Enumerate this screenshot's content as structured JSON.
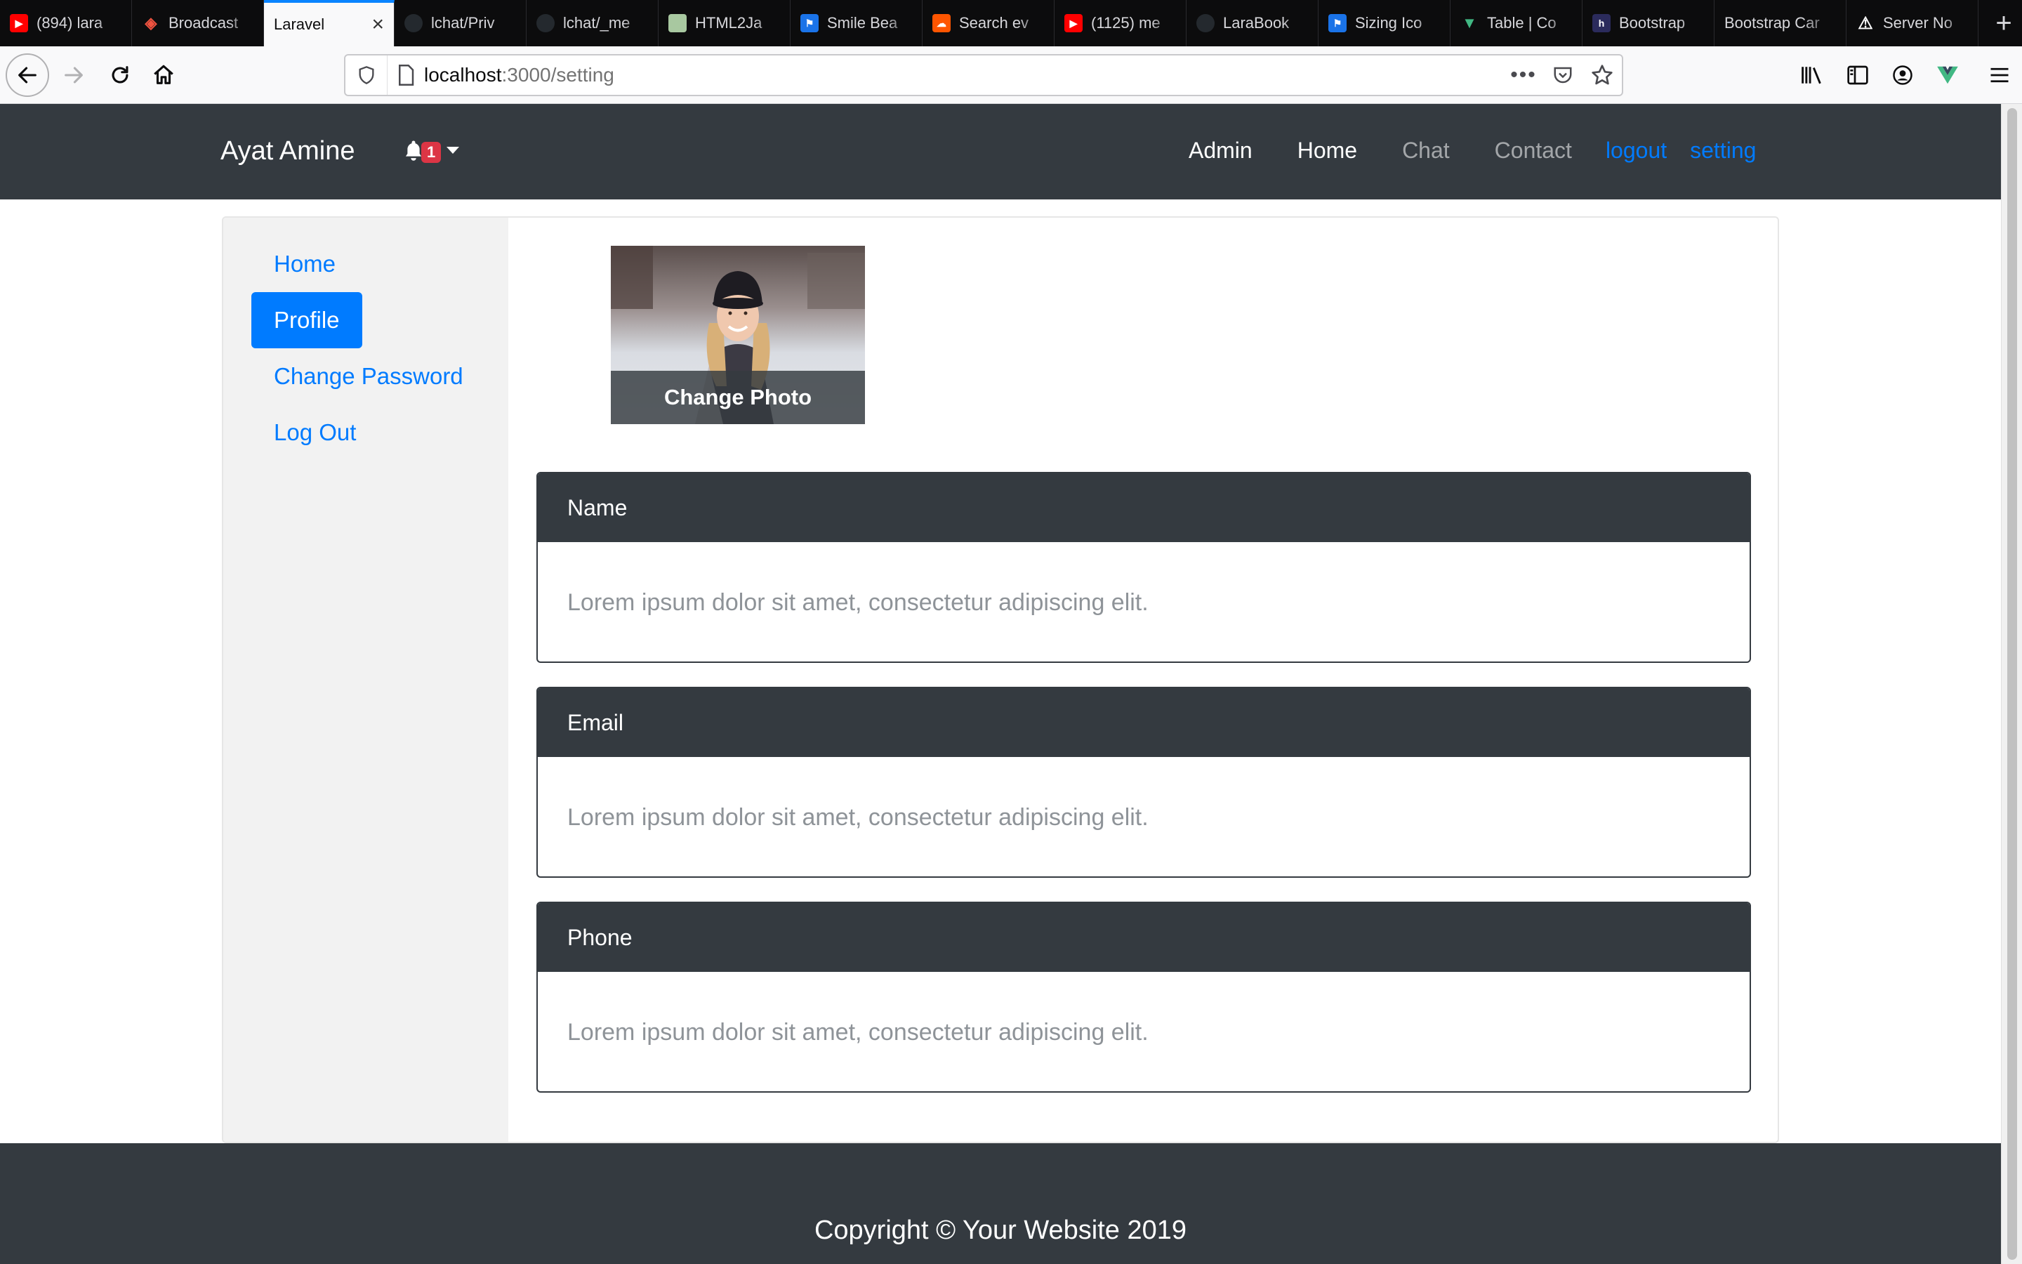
{
  "browser": {
    "tabs": [
      {
        "title": "(894) lara",
        "icon": "youtube-icon",
        "color": "#ff0000"
      },
      {
        "title": "Broadcast",
        "icon": "laravel-icon",
        "color": "#f05340"
      },
      {
        "title": "Laravel",
        "icon": "",
        "color": "",
        "active": true
      },
      {
        "title": "lchat/Priv",
        "icon": "github-icon",
        "color": "#24292e"
      },
      {
        "title": "lchat/_me",
        "icon": "github-icon",
        "color": "#24292e"
      },
      {
        "title": "HTML2Ja",
        "icon": "html2jade-icon",
        "color": "#a8c8a0"
      },
      {
        "title": "Smile Bea",
        "icon": "flag-icon",
        "color": "#1a73e8"
      },
      {
        "title": "Search ev",
        "icon": "soundcloud-icon",
        "color": "#ff5500"
      },
      {
        "title": "(1125) me",
        "icon": "youtube-icon",
        "color": "#ff0000"
      },
      {
        "title": "LaraBook",
        "icon": "github-icon",
        "color": "#24292e"
      },
      {
        "title": "Sizing Ico",
        "icon": "flag-icon",
        "color": "#1a73e8"
      },
      {
        "title": "Table | Co",
        "icon": "vuetify-icon",
        "color": "#41b883"
      },
      {
        "title": "Bootstrap",
        "icon": "bootstrap-h-icon",
        "color": "#2b2b5c"
      },
      {
        "title": "Bootstrap Car",
        "icon": "",
        "color": ""
      },
      {
        "title": "Server No",
        "icon": "warning-icon",
        "color": "#ffffff"
      }
    ],
    "url_host": "localhost",
    "url_rest": ":3000/setting"
  },
  "navbar": {
    "brand": "Ayat Amine",
    "notification_count": "1",
    "links": [
      {
        "label": "Admin",
        "style": "w"
      },
      {
        "label": "Home",
        "style": "w"
      },
      {
        "label": "Chat",
        "style": "g"
      },
      {
        "label": "Contact",
        "style": "g"
      },
      {
        "label": "logout",
        "style": "b"
      },
      {
        "label": "setting",
        "style": "b"
      }
    ]
  },
  "sidebar": {
    "items": [
      {
        "label": "Home",
        "active": false
      },
      {
        "label": "Profile",
        "active": true
      },
      {
        "label": "Change Password",
        "active": false
      },
      {
        "label": "Log Out",
        "active": false
      }
    ]
  },
  "profile": {
    "change_photo_label": "Change Photo"
  },
  "fields": [
    {
      "label": "Name",
      "value": "Lorem ipsum dolor sit amet, consectetur adipiscing elit."
    },
    {
      "label": "Email",
      "value": "Lorem ipsum dolor sit amet, consectetur adipiscing elit."
    },
    {
      "label": "Phone",
      "value": "Lorem ipsum dolor sit amet, consectetur adipiscing elit."
    }
  ],
  "footer": {
    "text": "Copyright © Your Website 2019"
  },
  "colors": {
    "primary": "#007bff",
    "dark": "#343a40",
    "badge": "#dc3545"
  }
}
